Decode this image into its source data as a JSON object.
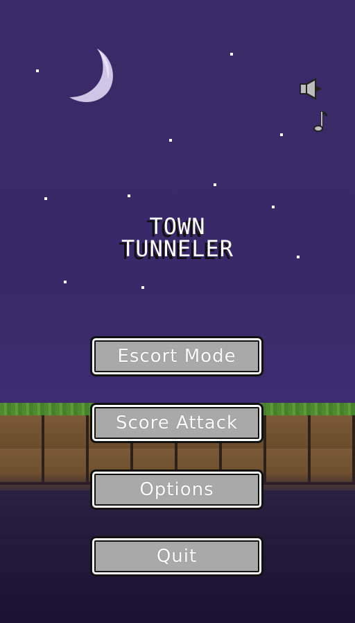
{
  "title": {
    "line1": "TOWN",
    "line2": "TUNNELER"
  },
  "icons": {
    "sound": "speaker-icon",
    "music": "music-note-icon",
    "moon": "crescent-moon-icon"
  },
  "menu": {
    "escort_label": "Escort Mode",
    "score_label": "Score Attack",
    "options_label": "Options",
    "quit_label": "Quit"
  },
  "colors": {
    "sky": "#3b2a66",
    "button_fill": "#a9a9a9",
    "grass": "#4f8a31",
    "dirt": "#6b4e2e"
  }
}
